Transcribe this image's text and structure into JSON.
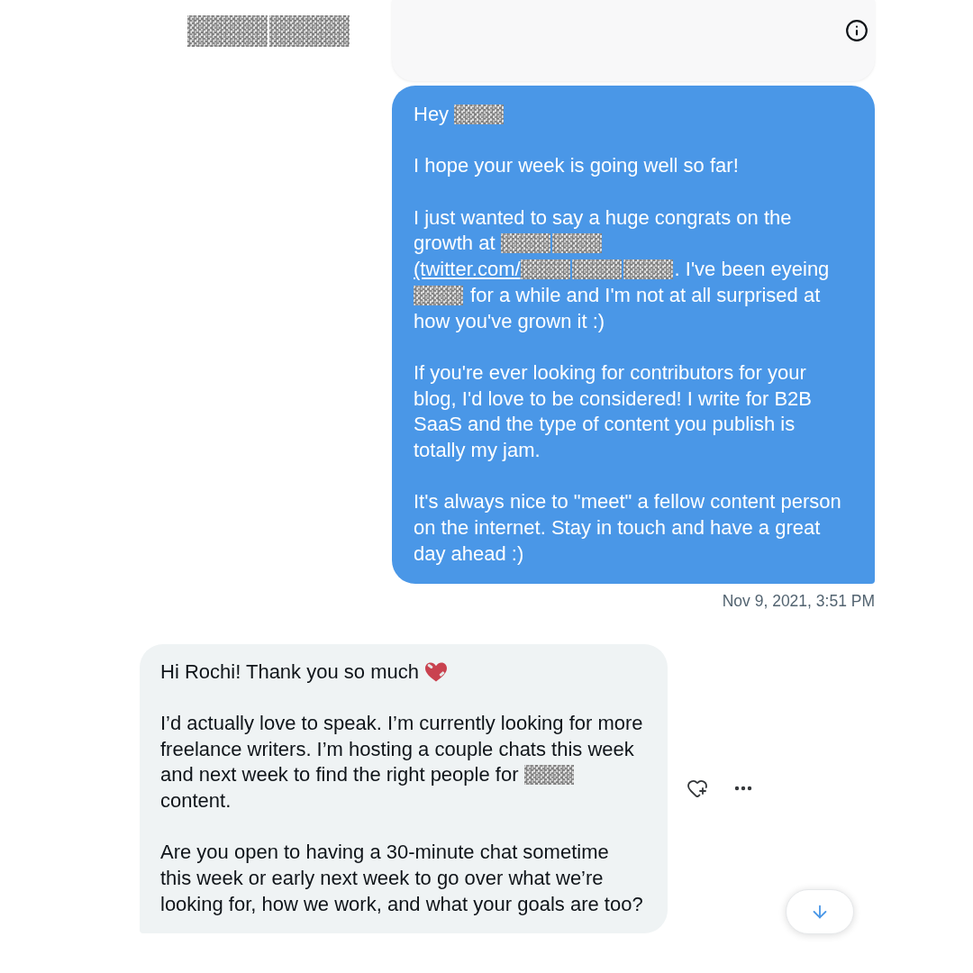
{
  "header": {
    "name": [
      {
        "kind": "redacted"
      },
      {
        "kind": "redacted"
      }
    ]
  },
  "messages": [
    {
      "kind": "outgoing",
      "cut_off": true,
      "hovered": false
    },
    {
      "kind": "outgoing",
      "cut_off": false,
      "hovered": false,
      "paragraphs": [
        [
          {
            "kind": "text",
            "text": "Hey "
          },
          {
            "kind": "redacted"
          }
        ],
        [
          {
            "kind": "text",
            "text": "I hope your week is going well so far!"
          }
        ],
        [
          {
            "kind": "text",
            "text": "I just wanted to say a huge congrats on the\ngrowth at "
          },
          {
            "kind": "redacted"
          },
          {
            "kind": "redacted"
          },
          {
            "kind": "link",
            "parts": [
              {
                "kind": "text",
                "text": "(twitter.com/"
              },
              {
                "kind": "redacted"
              },
              {
                "kind": "redacted"
              },
              {
                "kind": "redacted"
              }
            ]
          },
          {
            "kind": "text",
            "text": ". I've been eyeing\n"
          },
          {
            "kind": "redacted"
          },
          {
            "kind": "text",
            "text": " for a while and I'm not at all surprised at\nhow you've grown it :)"
          }
        ],
        [
          {
            "kind": "text",
            "text": "If you're ever looking for contributors for your\nblog, I'd love to be considered! I write for B2B\nSaaS and the type of content you publish is\ntotally my jam."
          }
        ],
        [
          {
            "kind": "text",
            "text": "It's always nice to \"meet\" a fellow content person\non the internet. Stay in touch and have a great\nday ahead :)"
          }
        ]
      ],
      "timestamp": "Nov 9, 2021, 3:51 PM"
    },
    {
      "kind": "incoming",
      "cut_off": false,
      "hovered": true,
      "paragraphs": [
        [
          {
            "kind": "text",
            "text": "Hi Rochi! Thank you so much "
          },
          {
            "kind": "emoji"
          }
        ],
        [
          {
            "kind": "text",
            "text": "I’d actually love to speak. I’m currently looking for more\nfreelance writers. I’m hosting a couple chats this week\nand next week to find the right people for "
          },
          {
            "kind": "redacted"
          },
          {
            "kind": "text",
            "text": "\ncontent."
          }
        ],
        [
          {
            "kind": "text",
            "text": "Are you open to having a 30-minute chat sometime\nthis week or early next week to go over what we’re\nlooking for, how we work, and what your goals are too?"
          }
        ]
      ]
    }
  ]
}
